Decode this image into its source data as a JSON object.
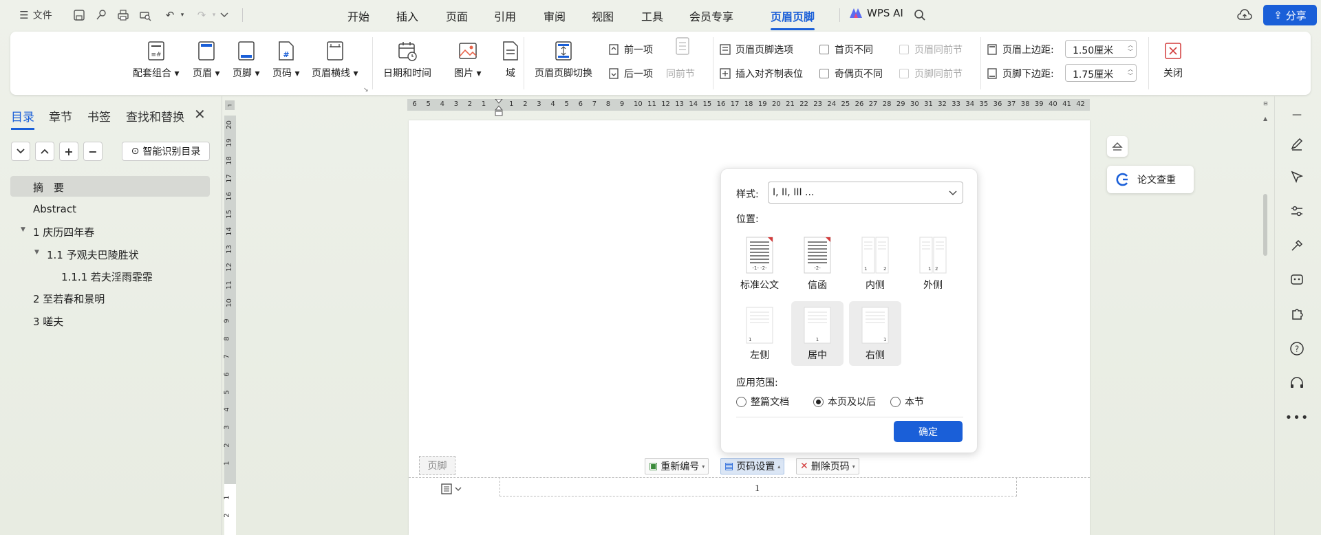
{
  "topbar": {
    "file_label": "文件",
    "menu_tabs": [
      "开始",
      "插入",
      "页面",
      "引用",
      "审阅",
      "视图",
      "工具",
      "会员专享",
      "页眉页脚"
    ],
    "active_tab": "页眉页脚",
    "wps_ai_label": "WPS AI",
    "share_label": "分享",
    "accent_color": "#1a5fd8"
  },
  "ribbon": {
    "big_buttons": [
      "配套组合",
      "页眉",
      "页脚",
      "页码",
      "页眉横线",
      "日期和时间",
      "图片",
      "域",
      "页眉页脚切换"
    ],
    "nav": {
      "prev": "前一项",
      "next": "后一项",
      "same_section": "同前节"
    },
    "options": {
      "hf_options": "页眉页脚选项",
      "insert_tab": "插入对齐制表位",
      "first_page_diff": "首页不同",
      "odd_even_diff": "奇偶页不同",
      "header_same_prev": "页眉同前节",
      "footer_same_prev": "页脚同前节"
    },
    "margins": {
      "header_top_label": "页眉上边距:",
      "header_top_value": "1.50厘米",
      "footer_bottom_label": "页脚下边距:",
      "footer_bottom_value": "1.75厘米"
    },
    "close_label": "关闭"
  },
  "leftpane": {
    "tabs": [
      "目录",
      "章节",
      "书签",
      "查找和替换"
    ],
    "smart_toc_label": "智能识别目录",
    "toc_items": [
      {
        "label": "摘　要",
        "level": 0,
        "selected": true
      },
      {
        "label": "Abstract",
        "level": 0
      },
      {
        "label": "1 庆历四年春",
        "level": 0,
        "expanded": true
      },
      {
        "label": "1.1 予观夫巴陵胜状",
        "level": 1,
        "expanded": true
      },
      {
        "label": "1.1.1 若夫淫雨霏霏",
        "level": 2
      },
      {
        "label": "2 至若春和景明",
        "level": 0
      },
      {
        "label": "3 嗟夫",
        "level": 0
      }
    ]
  },
  "ruler": {
    "h_left": [
      "6",
      "5",
      "4",
      "3",
      "2",
      "1"
    ],
    "h_right": [
      "1",
      "2",
      "3",
      "4",
      "5",
      "6",
      "7",
      "8",
      "9",
      "10",
      "11",
      "12",
      "13",
      "14",
      "15",
      "16",
      "17",
      "18",
      "19",
      "20",
      "21",
      "22",
      "23",
      "24",
      "25",
      "26",
      "27",
      "28",
      "29",
      "30",
      "31",
      "32",
      "33",
      "34",
      "35",
      "36",
      "37",
      "38",
      "39",
      "40",
      "41",
      "42"
    ],
    "v_top": [
      "20",
      "19",
      "18",
      "17",
      "16",
      "15",
      "14",
      "13",
      "12",
      "11",
      "10",
      "9",
      "8",
      "7",
      "6",
      "5",
      "4",
      "3",
      "2",
      "1"
    ],
    "v_bottom": [
      "1",
      "2"
    ]
  },
  "dialog": {
    "style_label": "样式:",
    "style_value": "I, II, III ...",
    "position_label": "位置:",
    "positions": [
      "标准公文",
      "信函",
      "内侧",
      "外侧",
      "左侧",
      "居中",
      "右侧"
    ],
    "selected_position": "居中",
    "scope_label": "应用范围:",
    "scope_options": [
      "整篇文档",
      "本页及以后",
      "本节"
    ],
    "selected_scope": "本页及以后",
    "ok_label": "确定"
  },
  "footer": {
    "tag": "页脚",
    "renumber": "重新编号",
    "page_number_settings": "页码设置",
    "delete_page_number": "删除页码",
    "page_number": "1"
  },
  "side": {
    "paper_check": "论文查重"
  }
}
